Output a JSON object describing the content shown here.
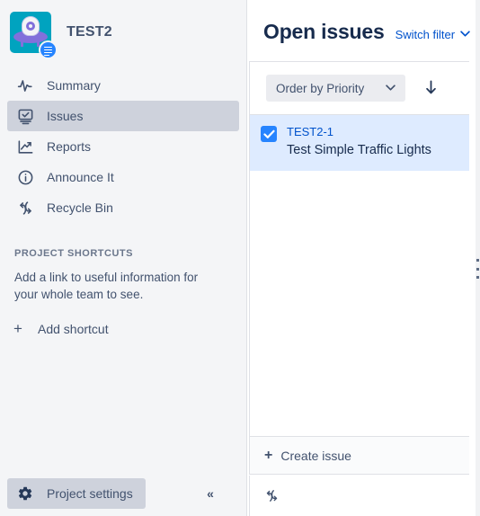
{
  "sidebar": {
    "project": {
      "name": "TEST2",
      "avatar_icon": "ufo-project-avatar",
      "badge_icon": "document-badge-icon",
      "avatar_bg": "#00a3bf",
      "avatar_accent": "#8270db",
      "badge_bg": "#2684ff"
    },
    "nav_items": [
      {
        "label": "Summary",
        "icon": "activity-pulse-icon",
        "active": false
      },
      {
        "label": "Issues",
        "icon": "issues-board-icon",
        "active": true
      },
      {
        "label": "Reports",
        "icon": "chart-trend-icon",
        "active": false
      },
      {
        "label": "Announce It",
        "icon": "info-circle-icon",
        "active": false
      },
      {
        "label": "Recycle Bin",
        "icon": "recycle-icon",
        "active": false
      }
    ],
    "shortcuts": {
      "heading": "PROJECT SHORTCUTS",
      "description": "Add a link to useful information for your whole team to see.",
      "add_label": "Add shortcut",
      "add_icon": "plus-icon"
    },
    "footer": {
      "settings_label": "Project settings",
      "settings_icon": "gear-icon",
      "collapse_icon": "double-chevron-left-icon",
      "collapse_glyph": "«",
      "active_bg": "#ced2dc"
    },
    "bg": "#f4f5f7"
  },
  "content": {
    "header": {
      "title": "Open issues",
      "switch_filter_label": "Switch filter",
      "switch_filter_icon": "chevron-down-icon",
      "switch_filter_glyph": "⌄",
      "link_color": "#0052cc"
    },
    "toolbar": {
      "order_by_label": "Order by Priority",
      "order_by_icon": "chevron-down-icon",
      "order_by_glyph": "⌄",
      "sort_direction_icon": "arrow-down-icon",
      "sort_direction_glyph": "↓"
    },
    "issues": [
      {
        "key": "TEST2-1",
        "summary": "Test Simple Traffic Lights",
        "checked": true,
        "selected": true,
        "checkbox_icon": "checkbox-checked-icon",
        "row_bg": "#deebff",
        "checkbox_bg": "#2684ff"
      }
    ],
    "create_issue": {
      "label": "Create issue",
      "icon": "plus-icon"
    },
    "footer": {
      "refresh_icon": "refresh-icon"
    },
    "resize_handle_icon": "drag-handle-dots-icon"
  }
}
